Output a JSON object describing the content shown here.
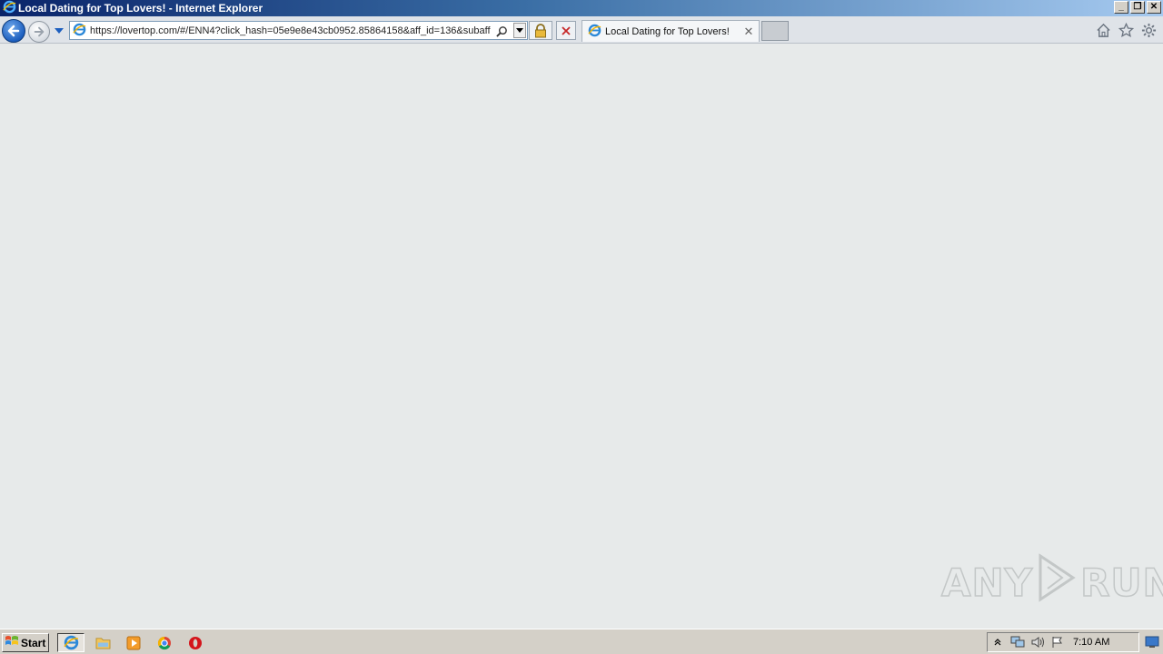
{
  "window": {
    "title": "Local Dating for Top Lovers! - Internet Explorer",
    "minimize_glyph": "_",
    "restore_glyph": "❐",
    "close_glyph": "✕"
  },
  "address_bar": {
    "url": "https://lovertop.com/#/ENN4?click_hash=05e9e8e43cb0952.85864158&aff_id=136&subaff"
  },
  "tabs": [
    {
      "label": "Local Dating for Top Lovers!",
      "close_glyph": "✕"
    }
  ],
  "toolbar_icons": [
    "home-icon",
    "favorites-star-icon",
    "tools-gear-icon"
  ],
  "watermark": {
    "left": "ANY",
    "right": "RUN"
  },
  "taskbar": {
    "start_label": "Start",
    "apps": [
      "internet-explorer-icon",
      "file-explorer-icon",
      "media-player-icon",
      "chrome-icon",
      "opera-icon"
    ],
    "tray_icons": [
      "tray-expand-icon",
      "network-icon",
      "volume-icon",
      "action-center-flag-icon"
    ],
    "clock": "7:10 AM"
  },
  "colors": {
    "titlebar_start": "#0a246a",
    "titlebar_end": "#a6caf0",
    "page_background": "#e7eaea",
    "taskbar": "#d4d0c8"
  }
}
